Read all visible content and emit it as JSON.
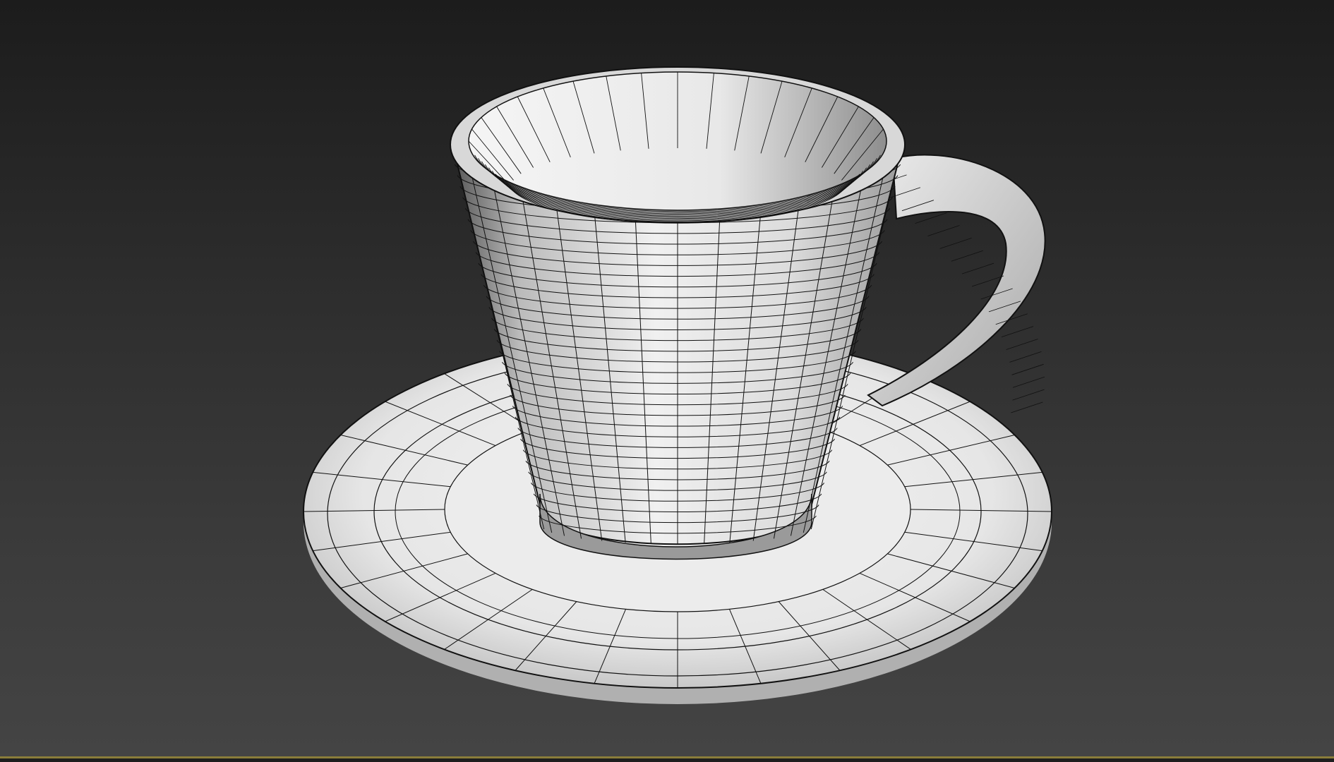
{
  "viewport": {
    "background_top": "#1c1c1c",
    "background_bottom": "#444444",
    "border_color": "#8a7d3a",
    "render_mode": "wireframe-on-shaded"
  },
  "scene": {
    "objects": [
      {
        "name": "cup",
        "icon": "cup-mesh"
      },
      {
        "name": "handle",
        "icon": "handle-mesh"
      },
      {
        "name": "saucer",
        "icon": "saucer-mesh"
      }
    ],
    "mesh_color": "#f2f2f2",
    "wire_color": "#111111"
  }
}
